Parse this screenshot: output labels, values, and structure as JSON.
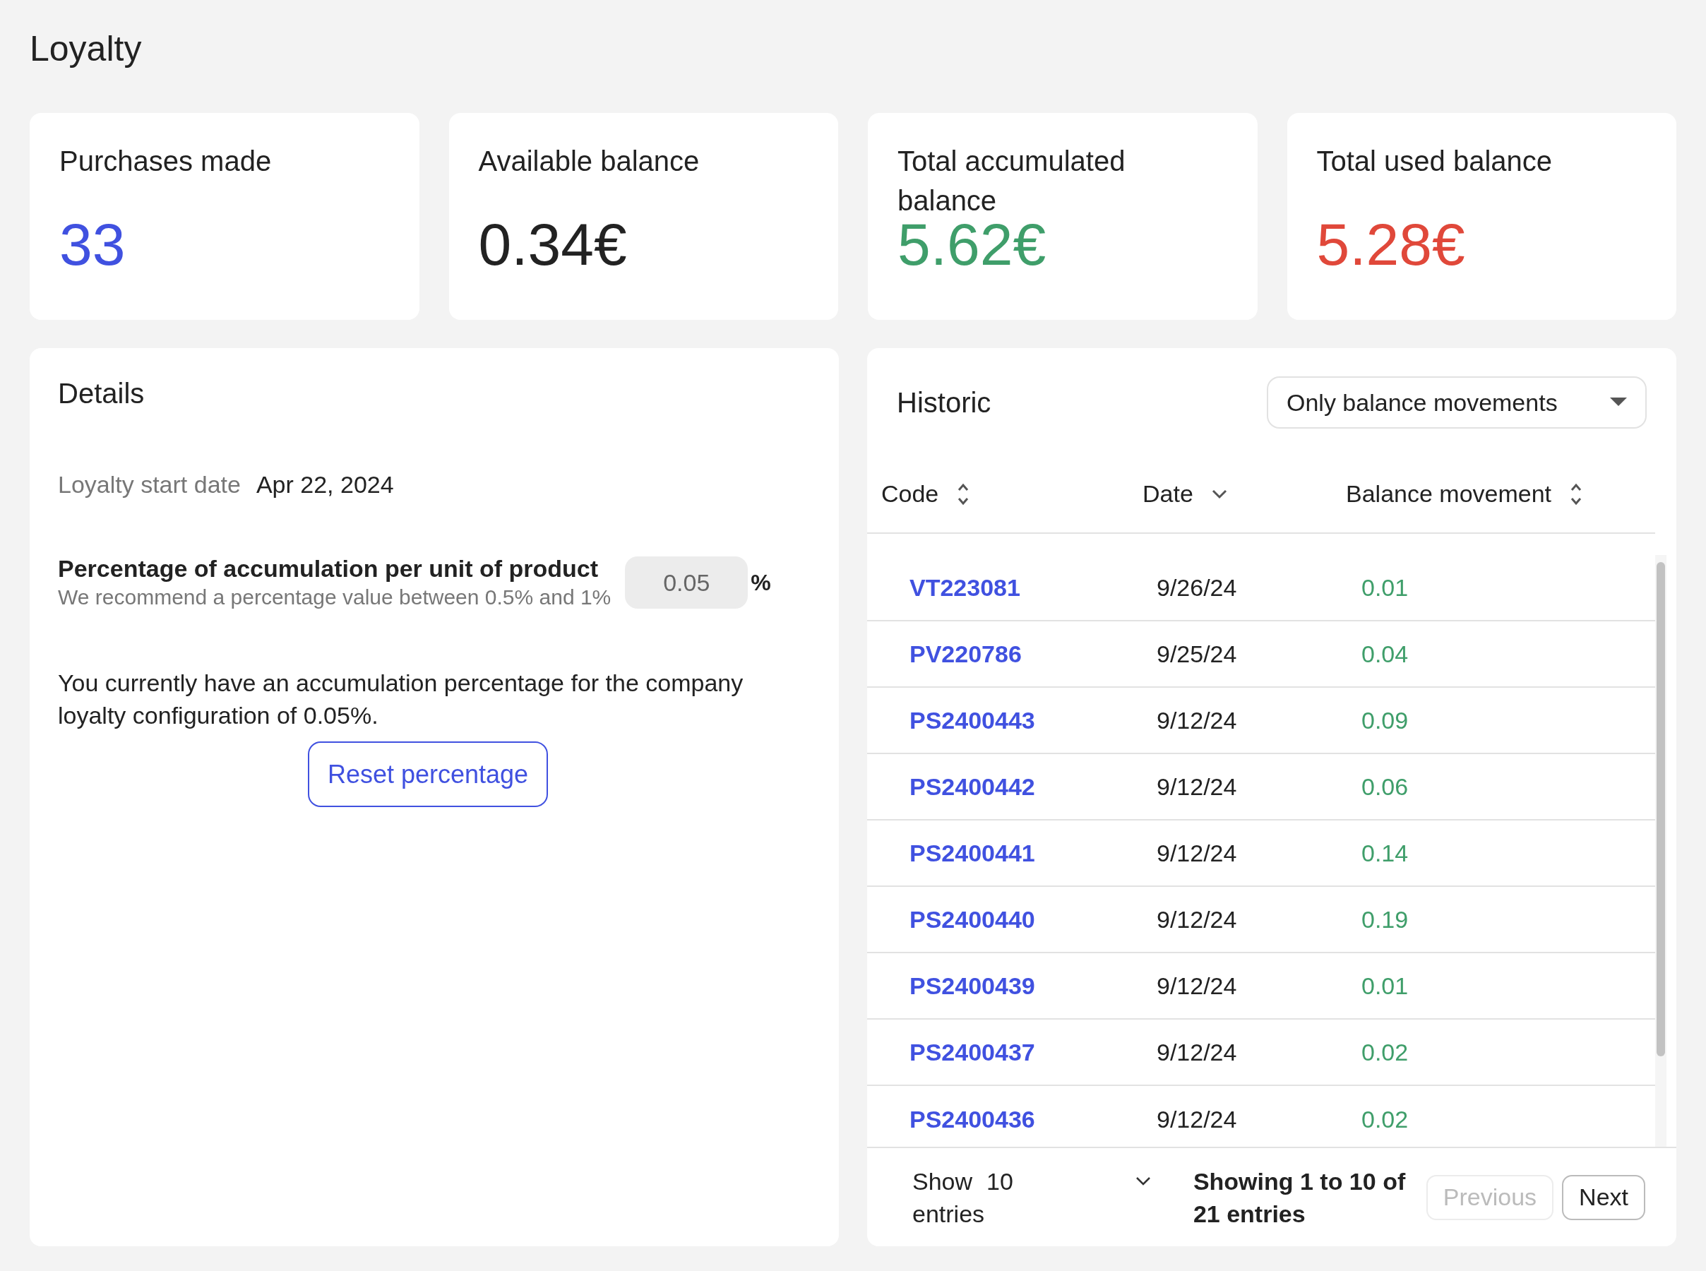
{
  "page": {
    "title": "Loyalty"
  },
  "stats": [
    {
      "label": "Purchases made",
      "value": "33",
      "color": "#4051e0"
    },
    {
      "label": "Available balance",
      "value": "0.34€",
      "color": "#222222"
    },
    {
      "label": "Total accumulated balance",
      "value": "5.62€",
      "color": "#3f9e6a"
    },
    {
      "label": "Total used balance",
      "value": "5.28€",
      "color": "#e0483a"
    }
  ],
  "details": {
    "title": "Details",
    "start_label": "Loyalty start date",
    "start_value": "Apr 22, 2024",
    "percentage_label": "Percentage of accumulation per unit of product",
    "percentage_hint": "We recommend a percentage value between 0.5% and 1%",
    "percentage_value": "0.05",
    "percentage_unit": "%",
    "note": "You currently have an accumulation percentage for the company loyalty configuration of 0.05%.",
    "reset_button": "Reset percentage"
  },
  "historic": {
    "title": "Historic",
    "filter": "Only balance movements",
    "columns": [
      {
        "label": "Code",
        "kind": "sortable"
      },
      {
        "label": "Date",
        "kind": "sorted"
      },
      {
        "label": "Balance movement",
        "kind": "sortable"
      }
    ],
    "rows": [
      {
        "code": "VT223081",
        "date": "9/26/24",
        "movement": "0.01"
      },
      {
        "code": "PV220786",
        "date": "9/25/24",
        "movement": "0.04"
      },
      {
        "code": "PS2400443",
        "date": "9/12/24",
        "movement": "0.09"
      },
      {
        "code": "PS2400442",
        "date": "9/12/24",
        "movement": "0.06"
      },
      {
        "code": "PS2400441",
        "date": "9/12/24",
        "movement": "0.14"
      },
      {
        "code": "PS2400440",
        "date": "9/12/24",
        "movement": "0.19"
      },
      {
        "code": "PS2400439",
        "date": "9/12/24",
        "movement": "0.01"
      },
      {
        "code": "PS2400437",
        "date": "9/12/24",
        "movement": "0.02"
      },
      {
        "code": "PS2400436",
        "date": "9/12/24",
        "movement": "0.02"
      }
    ],
    "show_label": "Show",
    "show_value": "10",
    "show_suffix": "entries",
    "summary": "Showing 1 to 10 of 21 entries",
    "previous": {
      "label": "Previous",
      "disabled": true
    },
    "next": {
      "label": "Next",
      "disabled": false
    }
  }
}
